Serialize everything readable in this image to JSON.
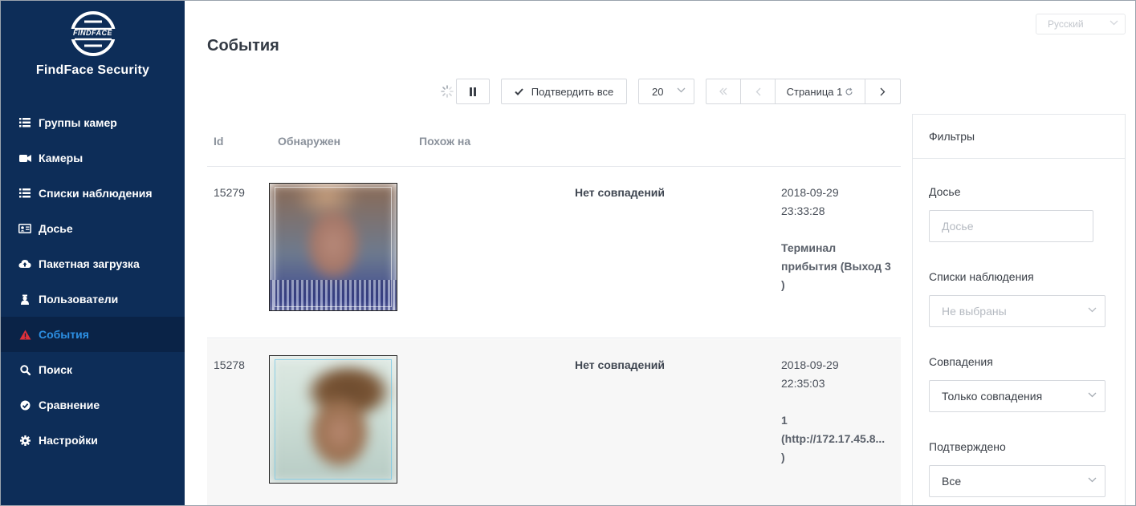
{
  "app": {
    "logo_text": "FINDFACE",
    "brand": "FindFace Security"
  },
  "sidebar": {
    "items": [
      {
        "label": "Группы камер",
        "icon": "list-icon",
        "active": false
      },
      {
        "label": "Камеры",
        "icon": "video-camera-icon",
        "active": false
      },
      {
        "label": "Списки наблюдения",
        "icon": "list-icon",
        "active": false
      },
      {
        "label": "Досье",
        "icon": "id-card-icon",
        "active": false
      },
      {
        "label": "Пакетная загрузка",
        "icon": "cloud-upload-icon",
        "active": false
      },
      {
        "label": "Пользователи",
        "icon": "user-icon",
        "active": false
      },
      {
        "label": "События",
        "icon": "warning-icon",
        "active": true
      },
      {
        "label": "Поиск",
        "icon": "search-icon",
        "active": false
      },
      {
        "label": "Сравнение",
        "icon": "check-circle-icon",
        "active": false
      },
      {
        "label": "Настройки",
        "icon": "gear-icon",
        "active": false
      }
    ]
  },
  "header": {
    "language": "Русский",
    "title": "События"
  },
  "toolbar": {
    "confirm_all": "Подтвердить все",
    "page_size": "20",
    "page_label": "Страница 1"
  },
  "table": {
    "columns": [
      "Id",
      "Обнаружен",
      "Похож на"
    ],
    "rows": [
      {
        "id": "15279",
        "match": "Нет совпадений",
        "date": "2018-09-29",
        "time": "23:33:28",
        "camera": "Терминал\nприбытия (Выход 3\n)"
      },
      {
        "id": "15278",
        "match": "Нет совпадений",
        "date": "2018-09-29",
        "time": "22:35:03",
        "camera": "1\n(http://172.17.45.8...\n)"
      }
    ]
  },
  "filters": {
    "title": "Фильтры",
    "dossier_label": "Досье",
    "dossier_placeholder": "Досье",
    "watchlists_label": "Списки наблюдения",
    "watchlists_value": "Не выбраны",
    "matches_label": "Совпадения",
    "matches_value": "Только совпадения",
    "acknowledged_label": "Подтверждено",
    "acknowledged_value": "Все"
  },
  "colors": {
    "sidebar_bg": "#0d2d58",
    "active_text": "#2c8fe3",
    "warning_icon": "#e0303a"
  }
}
